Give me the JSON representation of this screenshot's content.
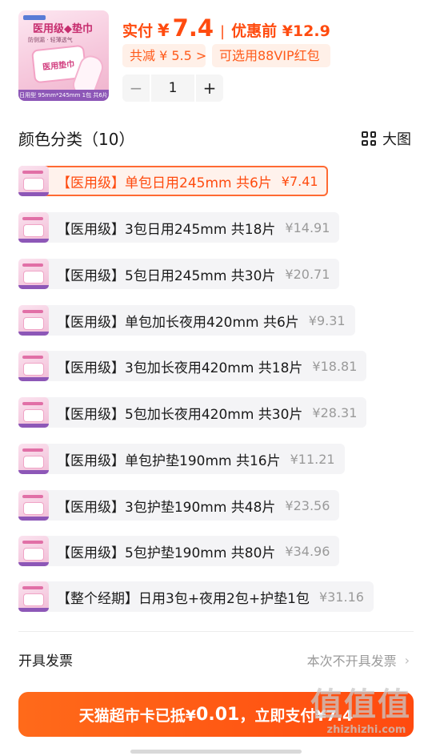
{
  "product": {
    "thumb_title": "医用级◆垫巾",
    "thumb_sub": "防侧漏 · 轻薄透气",
    "thumb_pack": "医用垫巾",
    "thumb_bar": "日用型 95mm*245mm 1包 共6片"
  },
  "price": {
    "paid_label": "实付",
    "currency": "¥",
    "paid_value": "7.4",
    "separator": "|",
    "before_label": "优惠前 ¥12.9"
  },
  "tags": {
    "saving": "共减 ¥ 5.5 >",
    "vip": "可选用88VIP红包"
  },
  "stepper": {
    "minus": "−",
    "qty": "1",
    "plus": "+"
  },
  "section": {
    "title": "颜色分类（10）",
    "big_view": "大图"
  },
  "options": [
    {
      "name": "【医用级】单包日用245mm 共6片",
      "price": "¥7.41",
      "selected": true
    },
    {
      "name": "【医用级】3包日用245mm 共18片",
      "price": "¥14.91",
      "selected": false
    },
    {
      "name": "【医用级】5包日用245mm 共30片",
      "price": "¥20.71",
      "selected": false
    },
    {
      "name": "【医用级】单包加长夜用420mm 共6片",
      "price": "¥9.31",
      "selected": false
    },
    {
      "name": "【医用级】3包加长夜用420mm 共18片",
      "price": "¥18.81",
      "selected": false
    },
    {
      "name": "【医用级】5包加长夜用420mm 共30片",
      "price": "¥28.31",
      "selected": false
    },
    {
      "name": "【医用级】单包护垫190mm 共16片",
      "price": "¥11.21",
      "selected": false
    },
    {
      "name": "【医用级】3包护垫190mm 共48片",
      "price": "¥23.56",
      "selected": false
    },
    {
      "name": "【医用级】5包护垫190mm 共80片",
      "price": "¥34.96",
      "selected": false
    },
    {
      "name": "【整个经期】日用3包+夜用2包+护垫1包",
      "price": "¥31.16",
      "selected": false
    }
  ],
  "invoice": {
    "label": "开具发票",
    "value": "本次不开具发票",
    "chevron": "›"
  },
  "pay_button": {
    "prefix": "天猫超市卡已抵¥",
    "amount": "0.01",
    "suffix": "，立即支付¥7.4"
  },
  "watermark": {
    "zh": "值值值",
    "en": "zhizhizhi.com"
  },
  "colors": {
    "accent": "#ff4b0f",
    "tag_bg": "#fff0e8",
    "option_bg": "#f4f4f6"
  }
}
